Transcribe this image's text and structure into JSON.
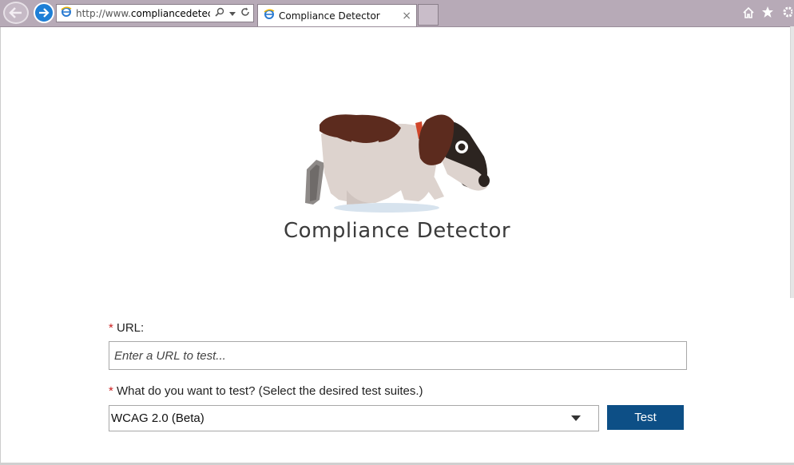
{
  "browser": {
    "address_prefix": "http://www.",
    "address_domain": "compliancedetec...",
    "tab_title": "Compliance Detector",
    "tab_close": "×"
  },
  "page": {
    "brand_name": "Compliance Detector",
    "form": {
      "required_mark": "*",
      "url_label": "URL:",
      "url_placeholder": "Enter a URL to test...",
      "test_label": "What do you want to test? (Select the desired test suites.)",
      "suite_selected": "WCAG 2.0 (Beta)",
      "test_button": "Test"
    }
  },
  "colors": {
    "chrome_bg": "#b7aab7",
    "accent_button": "#0d4f86",
    "required": "#cc1f1f"
  }
}
